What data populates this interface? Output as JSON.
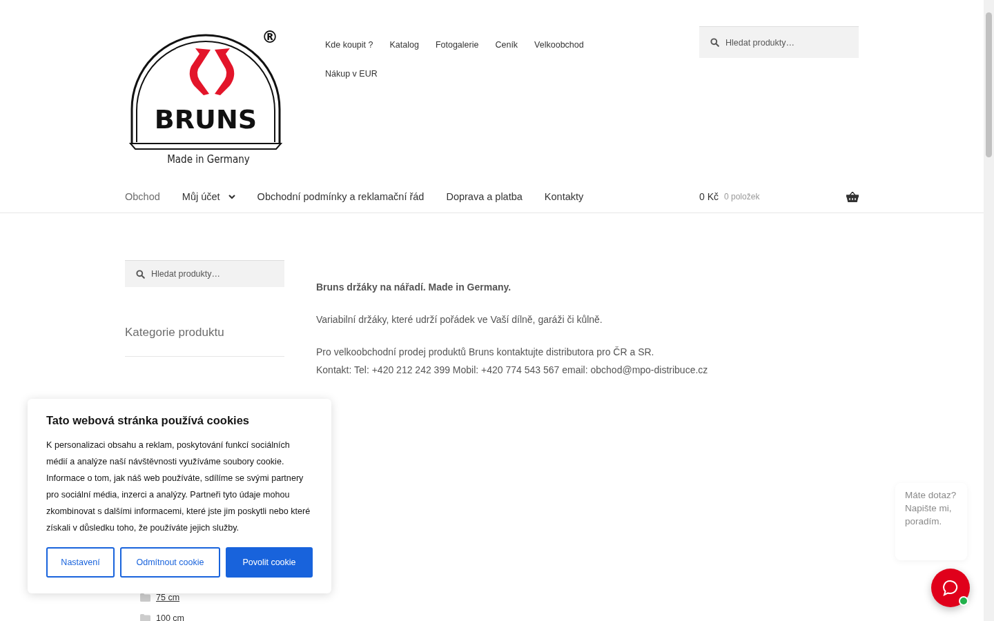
{
  "logo": {
    "registered": "®",
    "brand": "BRUNS",
    "tagline": "Made in Germany"
  },
  "top_nav": [
    {
      "label": "Kde koupit ?"
    },
    {
      "label": "Katalog"
    },
    {
      "label": "Fotogalerie"
    },
    {
      "label": "Ceník"
    },
    {
      "label": "Velkoobchod"
    },
    {
      "label": "Nákup v EUR"
    }
  ],
  "header_search": {
    "placeholder": "Hledat produkty…"
  },
  "main_nav": [
    {
      "label": "Obchod",
      "selected": true,
      "dropdown": false
    },
    {
      "label": "Můj účet",
      "selected": false,
      "dropdown": true
    },
    {
      "label": "Obchodní podmínky a reklamační řád",
      "selected": false,
      "dropdown": false
    },
    {
      "label": "Doprava a platba",
      "selected": false,
      "dropdown": false
    },
    {
      "label": "Kontakty",
      "selected": false,
      "dropdown": false
    }
  ],
  "cart": {
    "total": "0 Kč",
    "count": "0 položek"
  },
  "sidebar": {
    "search": {
      "placeholder": "Hledat produkty…"
    },
    "title": "Kategorie produktu",
    "categories": [
      {
        "label": "75 cm"
      },
      {
        "label": "100 cm"
      }
    ]
  },
  "content": {
    "paragraphs": [
      "**Bruns držáky na nářadí. Made in Germany.**",
      "Variabilní držáky, které udrží pořádek ve Vaší dílně, garáži či kůlně.",
      "Pro velkoobchodní prodej produktů Bruns kontaktujte distributora pro ČR a SR.\nKontakt: Tel: +420 212 242 399 Mobil: +420 774 543 567 email: obchod@mpo-distribuce.cz"
    ]
  },
  "cookie_banner": {
    "title": "Tato webová stránka používá cookies",
    "text": "K personalizaci obsahu a reklam, poskytování funkcí sociálních médií a analýze naší návštěvnosti využíváme soubory cookie. Informace o tom, jak náš web používáte, sdílíme se svými partnery pro sociální média, inzerci a analýzy. Partneři tyto údaje mohou zkombinovat s dalšími informacemi, které jste jim poskytli nebo které získali v důsledku toho, že používáte jejich služby.",
    "buttons": [
      {
        "label": "Nastavení",
        "kind": "outline"
      },
      {
        "label": "Odmítnout cookie",
        "kind": "outline"
      },
      {
        "label": "Povolit cookie",
        "kind": "primary"
      }
    ]
  },
  "chat": {
    "bubble": "Máte dotaz? Napište mi, poradím.",
    "online": true
  }
}
